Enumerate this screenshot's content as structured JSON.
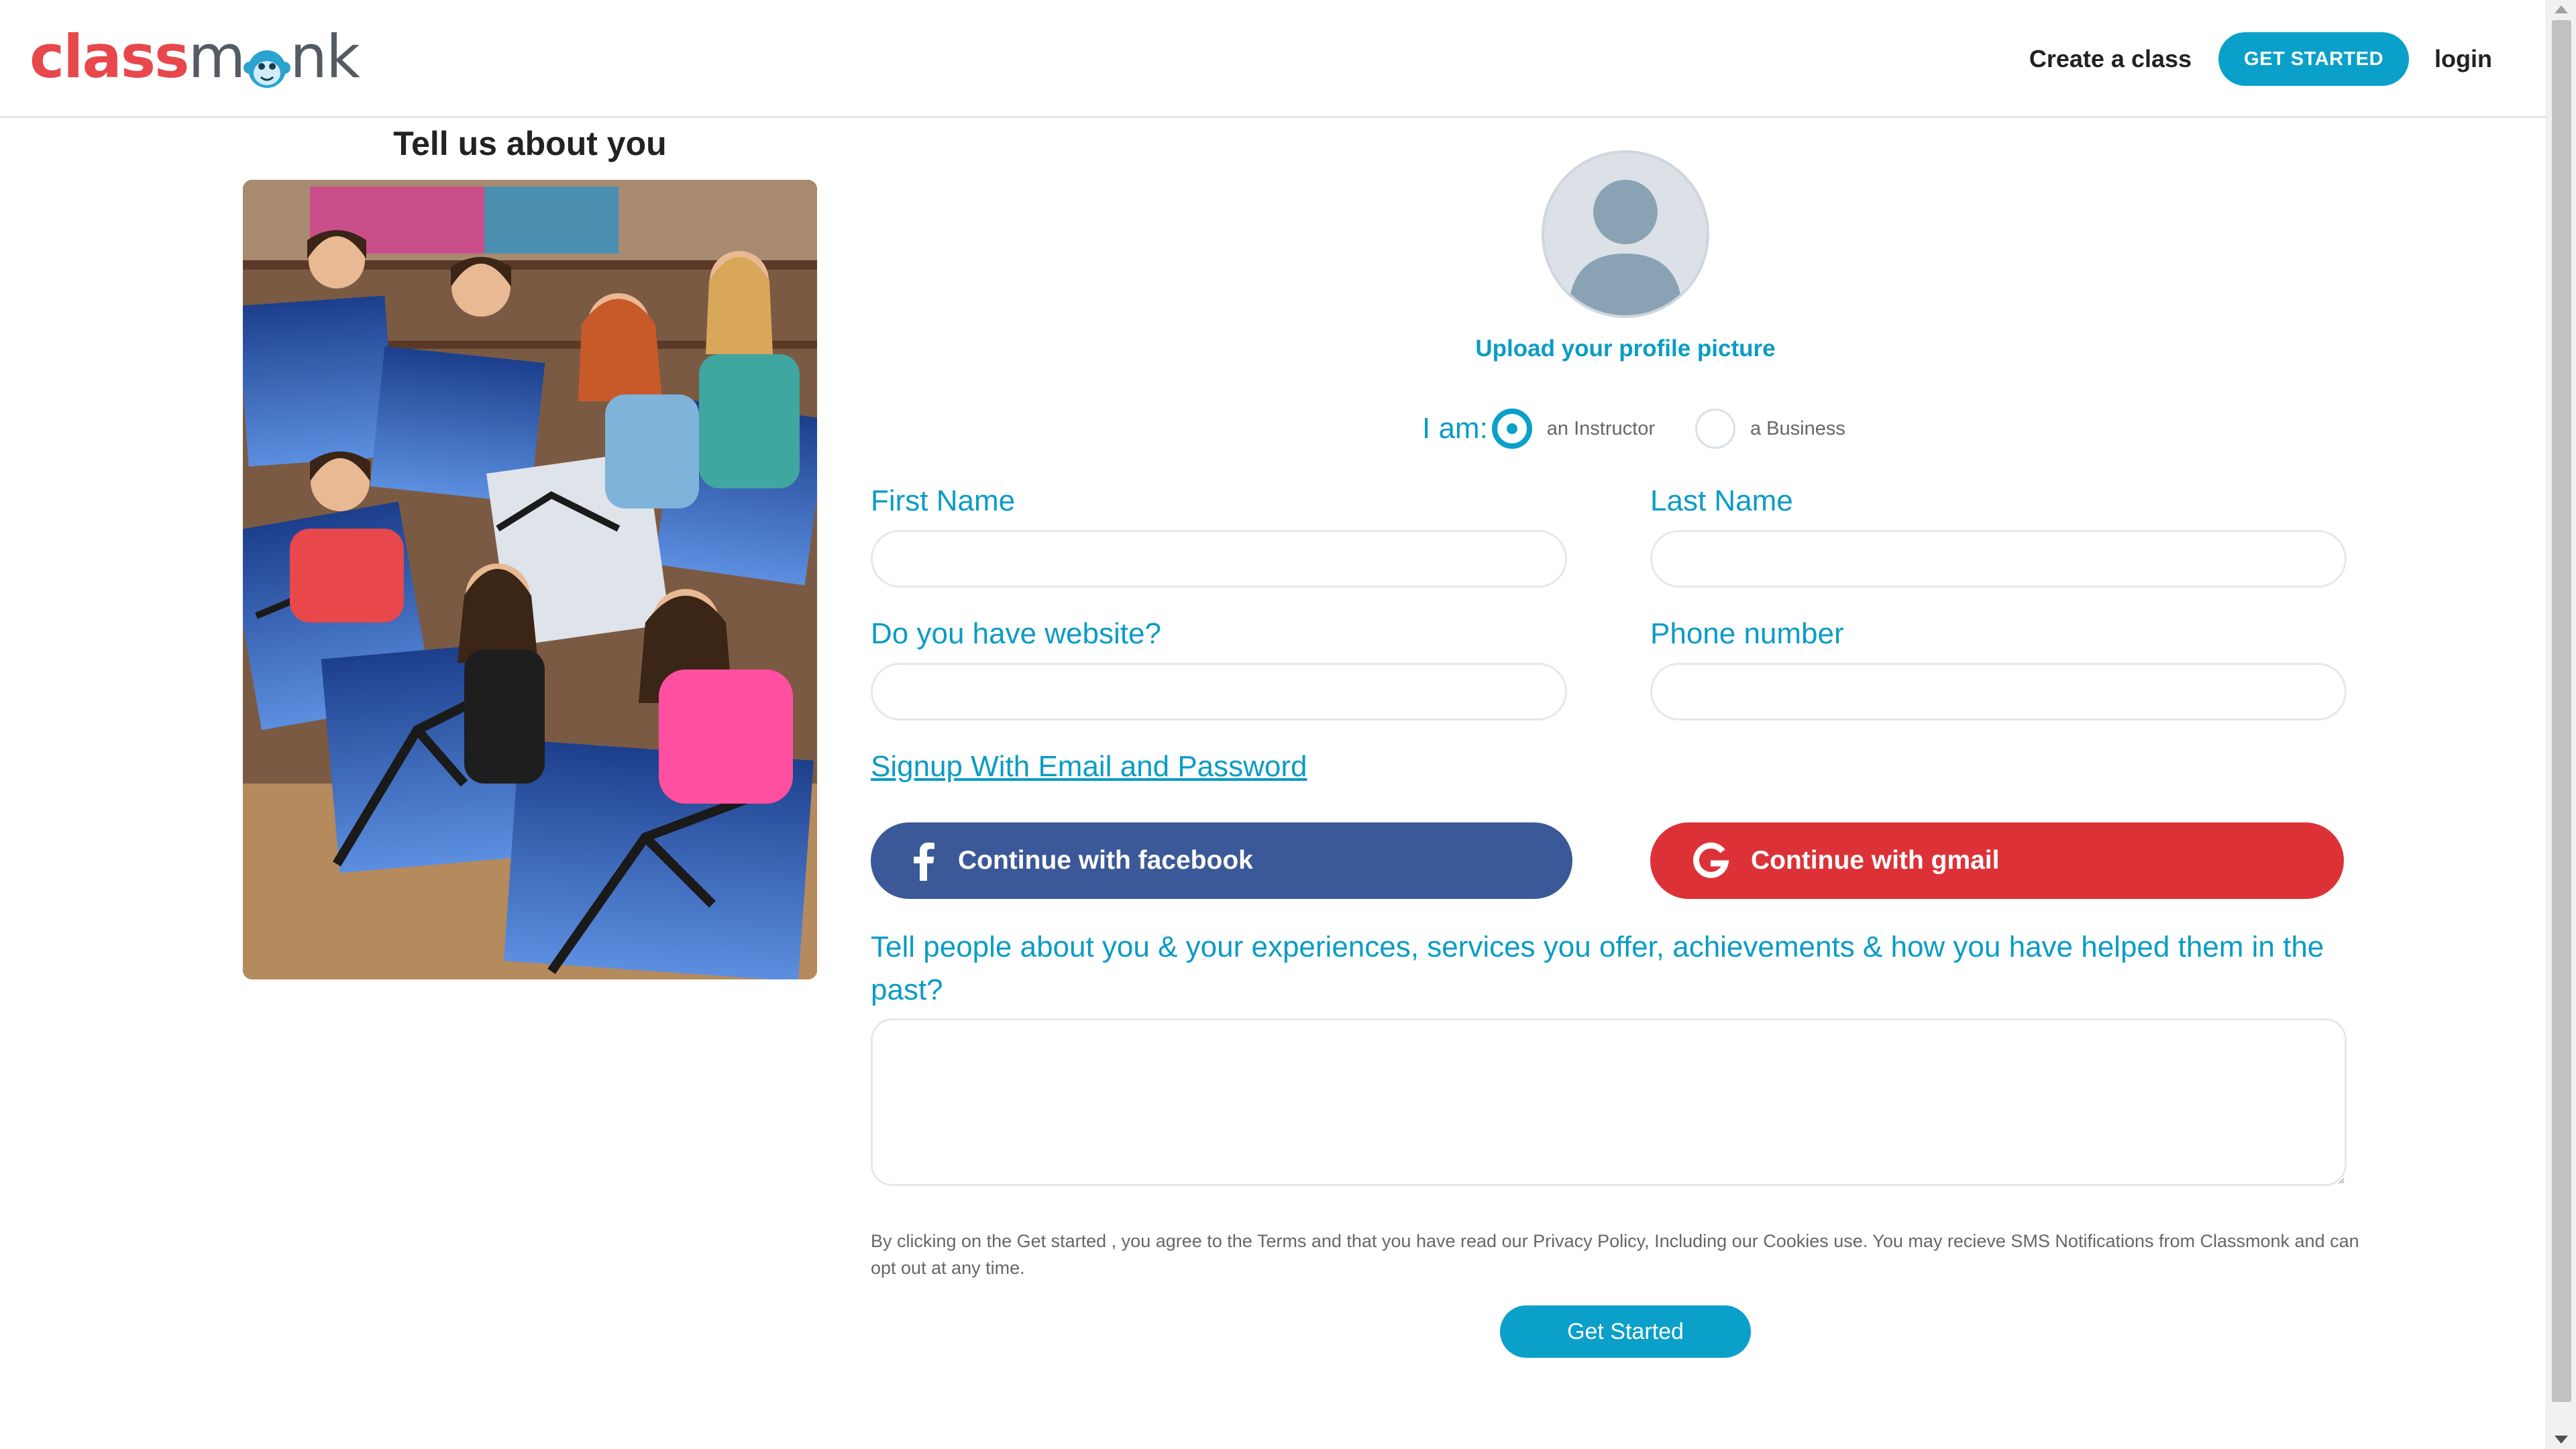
{
  "header": {
    "logo_text_1": "class",
    "logo_text_2": "m",
    "logo_text_3": "nk",
    "create_class": "Create a class",
    "get_started": "GET STARTED",
    "login": "login"
  },
  "left": {
    "title": "Tell us about you"
  },
  "profile": {
    "upload_label": "Upload your profile picture"
  },
  "role": {
    "label": "I am:",
    "options": [
      {
        "label": "an Instructor",
        "checked": true
      },
      {
        "label": "a Business",
        "checked": false
      }
    ]
  },
  "form": {
    "first_name_label": "First Name",
    "first_name_value": "",
    "last_name_label": "Last Name",
    "last_name_value": "",
    "website_label": "Do you have website?",
    "website_value": "",
    "phone_label": "Phone number",
    "phone_value": "",
    "signup_email_link": "Signup With Email and Password",
    "facebook_button": "Continue with facebook",
    "gmail_button": "Continue with gmail",
    "about_label": "Tell people about you & your experiences, services you offer, achievements & how you have helped them in the past?",
    "about_value": "",
    "terms_text": "By clicking on the Get started , you agree to the Terms and that you have read our Privacy Policy, Including our Cookies use. You may recieve SMS Notifications from Classmonk and can opt out at any time.",
    "submit_button": "Get Started"
  },
  "colors": {
    "accent": "#0aa0c9",
    "logo_red": "#e8474b",
    "facebook": "#3b5998",
    "gmail": "#dc3237"
  },
  "icons": {
    "logo": "monkey-icon",
    "avatar": "user-silhouette-icon",
    "facebook": "facebook-icon",
    "gmail": "google-icon"
  }
}
